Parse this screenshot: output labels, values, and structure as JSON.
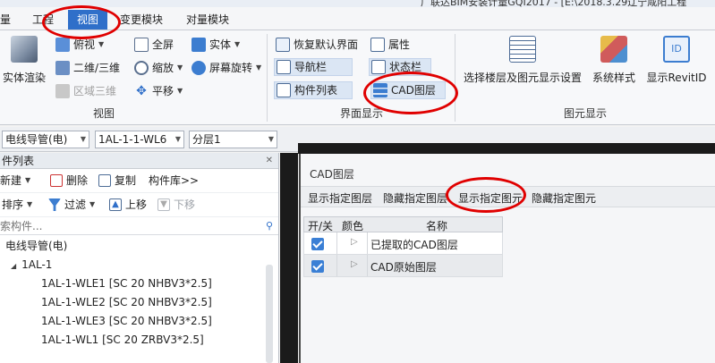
{
  "window": {
    "title": "广联达BIM安装计量GQI2017 - [E:\\2018.3.29辽宁咸阳工程"
  },
  "menu": {
    "tabs": [
      "量",
      "工程",
      "视图",
      "变更模块",
      "对量模块"
    ],
    "active": "视图"
  },
  "ribbon": {
    "groups": {
      "view": {
        "label": "视图",
        "render_label": "实体渲染",
        "top_view": "俯视",
        "view_2d3d": "二维/三维",
        "area_3d": "区域三维",
        "fullscreen": "全屏",
        "zoom": "缩放",
        "pan": "平移",
        "solid": "实体",
        "screen_rotate": "屏幕旋转"
      },
      "ui": {
        "label": "界面显示",
        "restore": "恢复默认界面",
        "properties": "属性",
        "navbar": "导航栏",
        "statusbar": "状态栏",
        "component_list": "构件列表",
        "cad_layer": "CAD图层"
      },
      "elements": {
        "label": "图元显示",
        "floor_display": "选择楼层及图元显示设置",
        "system_style": "系统样式",
        "show_revit": "显示RevitID"
      }
    }
  },
  "combos": {
    "type": "电线导管(电)",
    "component": "1AL-1-1-WL6",
    "layer": "分层1"
  },
  "component_list": {
    "title": "件列表",
    "new": "新建",
    "delete": "删除",
    "copy": "复制",
    "library": "构件库>>",
    "sort": "排序",
    "filter": "过滤",
    "move_up": "上移",
    "move_down": "下移",
    "search_placeholder": "索构件...",
    "tree": {
      "root": "电线导管(电)",
      "group": "1AL-1",
      "items": [
        "1AL-1-WLE1 [SC 20 NHBV3*2.5]",
        "1AL-1-WLE2 [SC 20 NHBV3*2.5]",
        "1AL-1-WLE3 [SC 20 NHBV3*2.5]",
        "1AL-1-WL1 [SC 20 ZRBV3*2.5]"
      ]
    }
  },
  "cad_panel": {
    "title": "CAD图层",
    "actions": [
      "显示指定图层",
      "隐藏指定图层",
      "显示指定图元",
      "隐藏指定图元"
    ],
    "headers": [
      "开/关",
      "颜色",
      "名称"
    ],
    "rows": [
      {
        "name": "已提取的CAD图层",
        "on": true
      },
      {
        "name": "CAD原始图层",
        "on": true
      }
    ]
  },
  "colors": {
    "accent": "#2f6fc9",
    "annotation": "#e00000"
  }
}
